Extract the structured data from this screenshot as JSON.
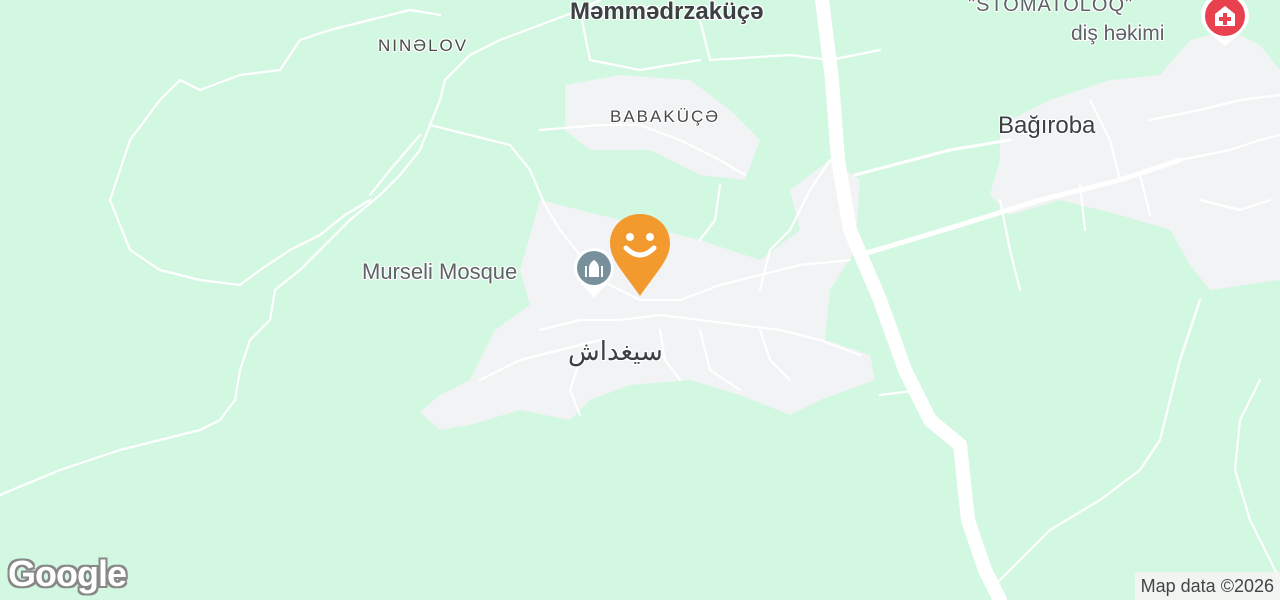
{
  "map": {
    "labels": {
      "top_village": "Məmmədrzaküçə",
      "ninelov": "NINƏLOV",
      "babakuce": "BABAKÜÇƏ",
      "bagiroba": "Bağıroba",
      "mosque": "Murseli Mosque",
      "siyghdash": "سيغداش",
      "dentist_title": "\"STOMATOLOQ\"",
      "dentist_sub": "diş həkimi"
    },
    "icons": {
      "mosque": "mosque-icon",
      "dentist": "hospital-cross-icon",
      "smiley_pin": "smiley-pin-icon"
    },
    "colors": {
      "land": "#d3f8e2",
      "urban": "#f1f3f4",
      "road": "#ffffff",
      "pin": "#f29a2e",
      "mosque_icon": "#78909c",
      "dentist_icon": "#e8424e"
    }
  },
  "branding": {
    "logo": "Google",
    "attribution": "Map data ©2026"
  }
}
